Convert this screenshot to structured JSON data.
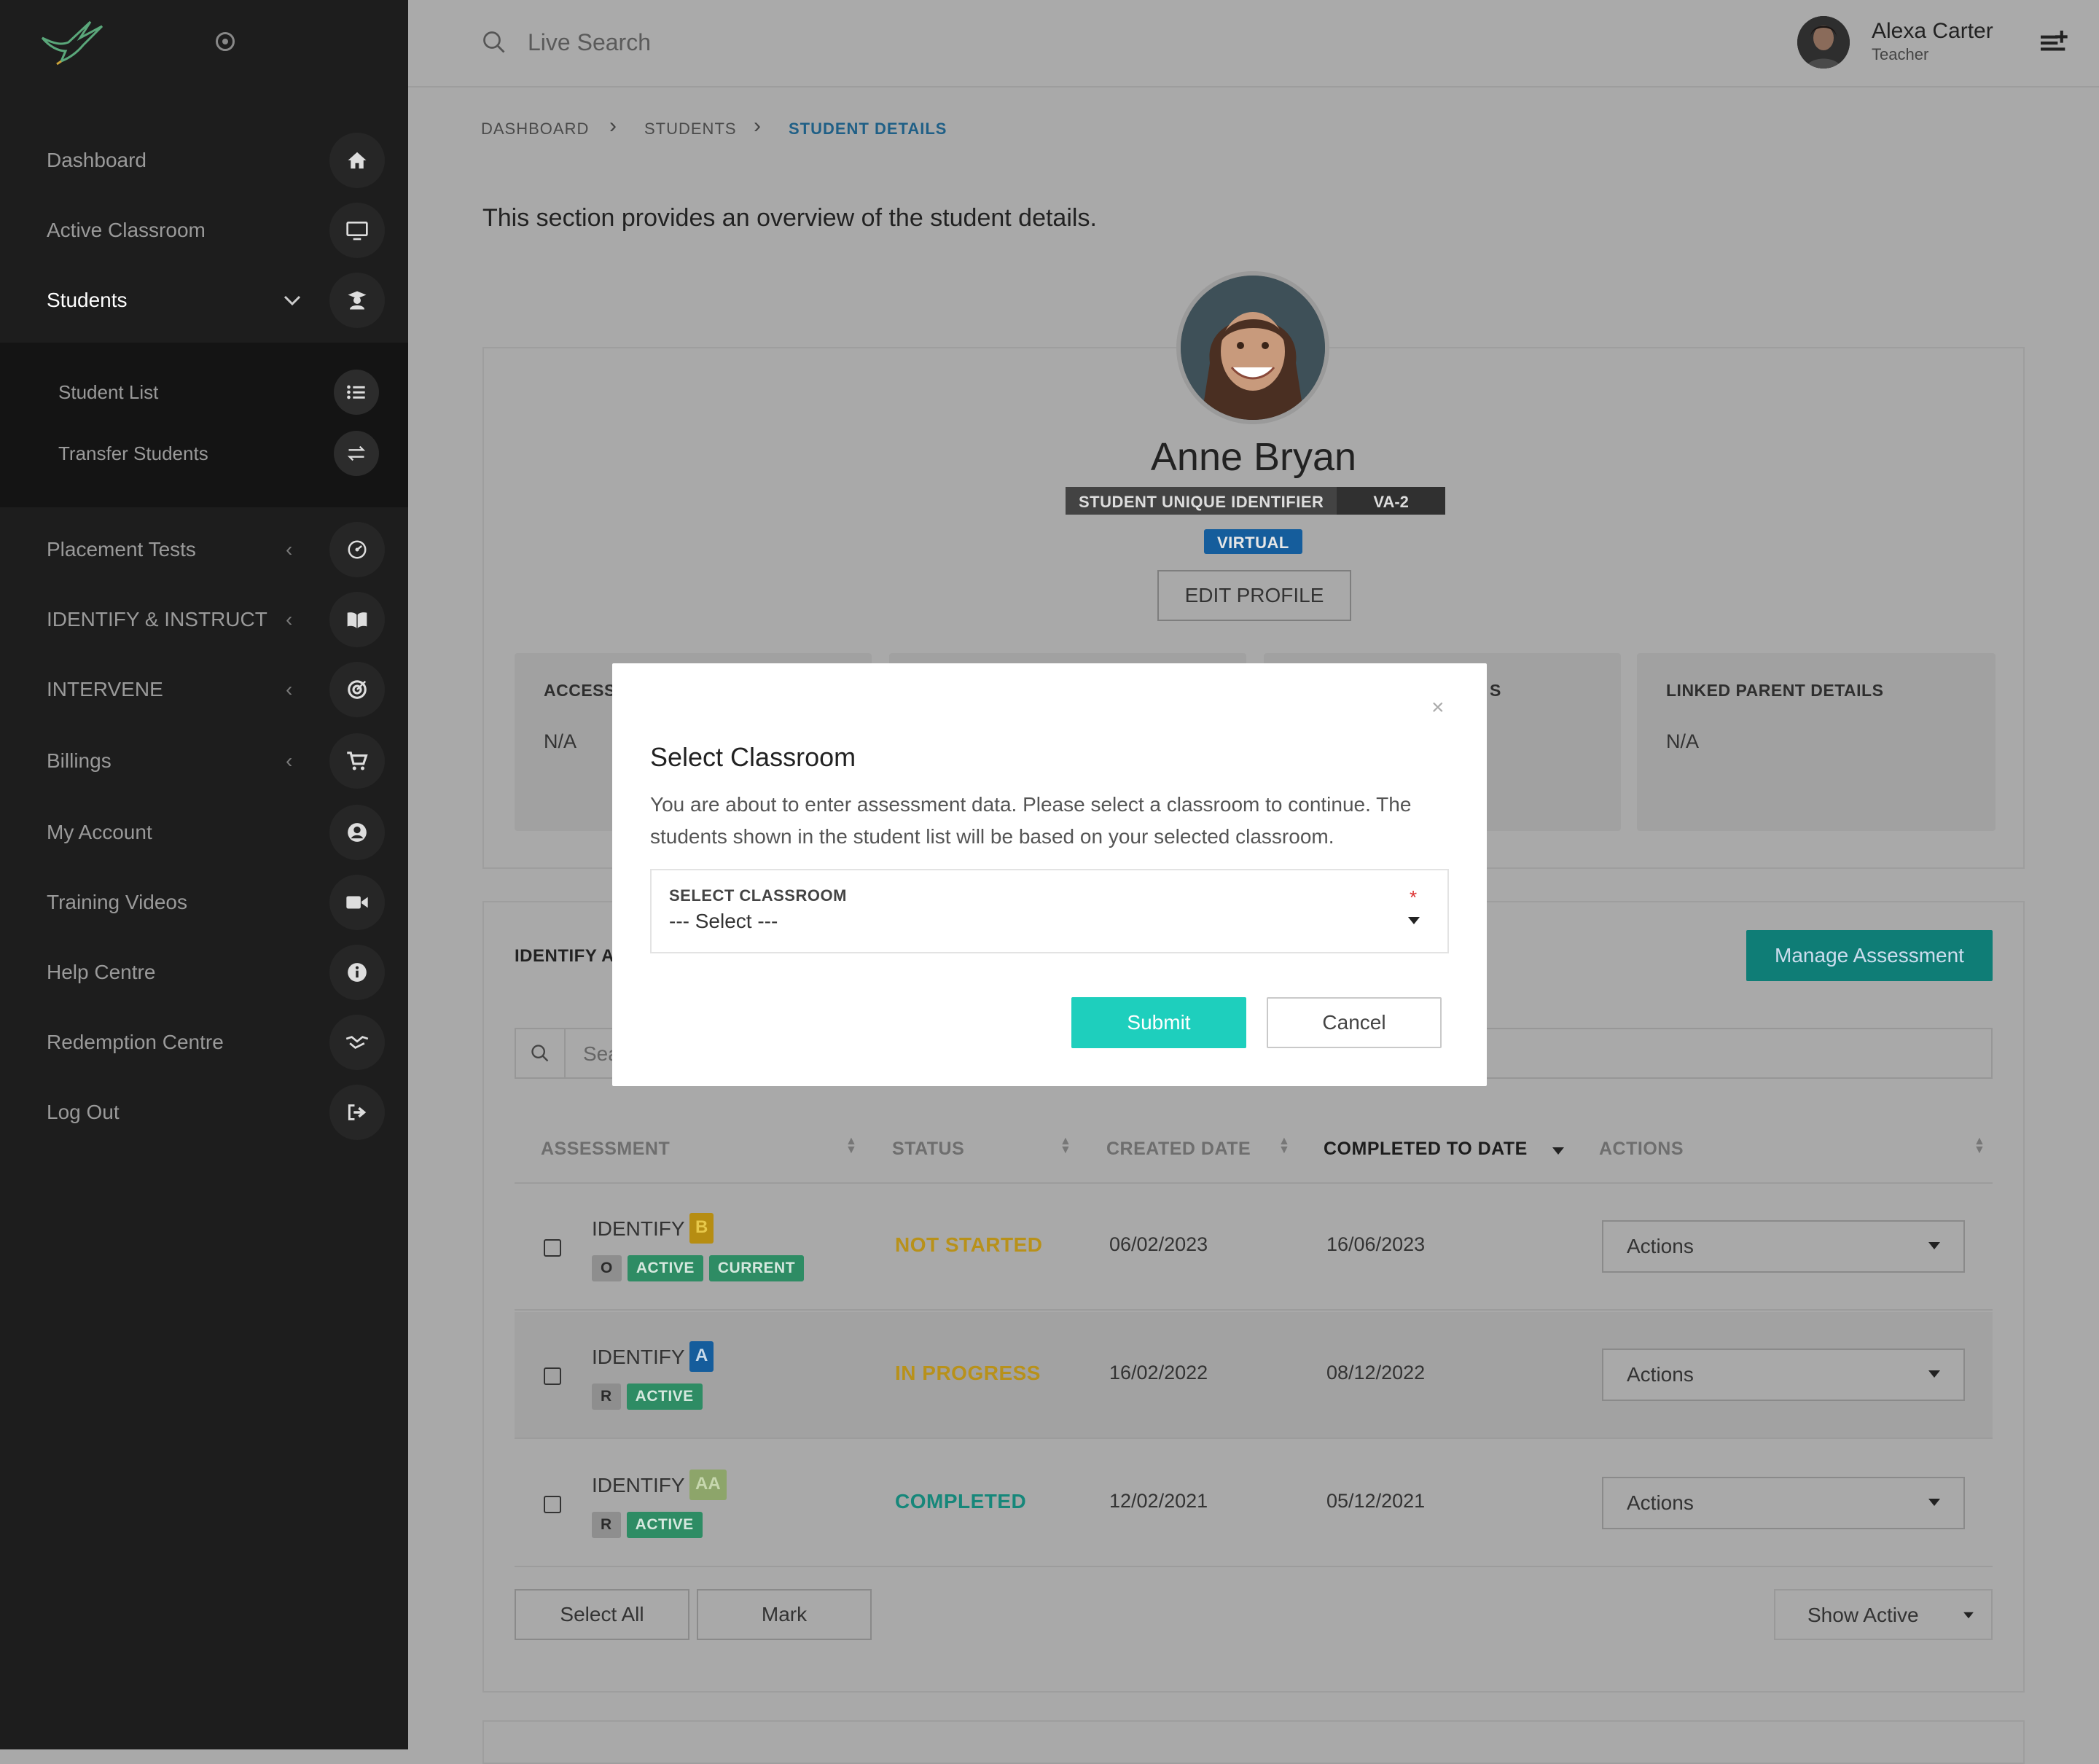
{
  "sidebar": {
    "items": [
      {
        "label": "Dashboard",
        "icon": "home-icon"
      },
      {
        "label": "Active Classroom",
        "icon": "monitor-icon"
      },
      {
        "label": "Students",
        "icon": "student-icon"
      },
      {
        "label": "Placement Tests",
        "icon": "dial-icon"
      },
      {
        "label": "IDENTIFY & INSTRUCT",
        "icon": "book-icon"
      },
      {
        "label": "INTERVENE",
        "icon": "target-icon"
      },
      {
        "label": "Billings",
        "icon": "cart-icon"
      },
      {
        "label": "My Account",
        "icon": "user-circle-icon"
      },
      {
        "label": "Training Videos",
        "icon": "video-icon"
      },
      {
        "label": "Help Centre",
        "icon": "info-icon"
      },
      {
        "label": "Redemption Centre",
        "icon": "handshake-icon"
      },
      {
        "label": "Log Out",
        "icon": "logout-icon"
      }
    ],
    "subitems": [
      {
        "label": "Student List",
        "icon": "list-icon"
      },
      {
        "label": "Transfer Students",
        "icon": "transfer-icon"
      }
    ]
  },
  "header": {
    "search_placeholder": "Live Search",
    "user_name": "Alexa Carter",
    "user_role": "Teacher"
  },
  "breadcrumb": [
    "DASHBOARD",
    "STUDENTS",
    "STUDENT DETAILS"
  ],
  "intro": "This section provides an overview of the student details.",
  "student": {
    "name": "Anne Bryan",
    "uid_label": "STUDENT UNIQUE IDENTIFIER",
    "uid_value": "VA-2",
    "mode": "VIRTUAL",
    "edit_label": "EDIT PROFILE"
  },
  "info_boxes": [
    {
      "title": "ACCESS",
      "value": "N/A"
    },
    {
      "title": "",
      "value": ""
    },
    {
      "title": "S",
      "value": ""
    },
    {
      "title": "LINKED PARENT DETAILS",
      "value": "N/A"
    }
  ],
  "assessments": {
    "title": "IDENTIFY A",
    "manage_label": "Manage Assessment",
    "search_placeholder": "Sea",
    "columns": [
      "ASSESSMENT",
      "STATUS",
      "CREATED DATE",
      "COMPLETED TO DATE",
      "ACTIONS"
    ],
    "rows": [
      {
        "name": "IDENTIFY",
        "level": "B",
        "level_color": "#b68d12",
        "tags": [
          "O",
          "ACTIVE",
          "CURRENT"
        ],
        "status": "NOT STARTED",
        "status_color": "#b8911a",
        "created": "06/02/2023",
        "completed": "16/06/2023",
        "action": "Actions"
      },
      {
        "name": "IDENTIFY",
        "level": "A",
        "level_color": "#155d9c",
        "tags": [
          "R",
          "ACTIVE"
        ],
        "status": "IN PROGRESS",
        "status_color": "#b8911a",
        "created": "16/02/2022",
        "completed": "08/12/2022",
        "action": "Actions"
      },
      {
        "name": "IDENTIFY",
        "level": "AA",
        "level_color": "#8da56a",
        "tags": [
          "R",
          "ACTIVE"
        ],
        "status": "COMPLETED",
        "status_color": "#16877a",
        "created": "12/02/2021",
        "completed": "05/12/2021",
        "action": "Actions"
      }
    ],
    "select_all": "Select All",
    "mark": "Mark",
    "show_active": "Show Active"
  },
  "modal": {
    "close": "×",
    "title": "Select Classroom",
    "text": "You are about to enter assessment data. Please select a classroom to continue. The students shown in the student list will be based on your selected classroom.",
    "select_label": "SELECT CLASSROOM",
    "required_mark": "*",
    "select_value": "--- Select ---",
    "submit": "Submit",
    "cancel": "Cancel"
  }
}
